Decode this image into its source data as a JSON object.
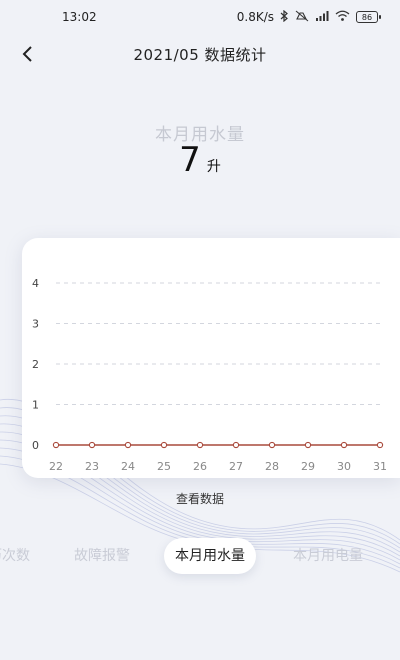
{
  "status_bar": {
    "time": "13:02",
    "network_speed": "0.8K/s",
    "icons": [
      "bluetooth-icon",
      "mute-icon",
      "signal-icon",
      "wifi-icon"
    ],
    "battery": "86"
  },
  "header": {
    "title": "2021/05 数据统计",
    "back_icon": "chevron-left-icon"
  },
  "summary": {
    "label": "本月用水量",
    "value": "7",
    "unit": "升"
  },
  "chart_data": {
    "type": "line",
    "x": [
      "22",
      "23",
      "24",
      "25",
      "26",
      "27",
      "28",
      "29",
      "30",
      "31"
    ],
    "values": [
      0,
      0,
      0,
      0,
      0,
      0,
      0,
      0,
      0,
      0
    ],
    "yticks": [
      "0",
      "1",
      "2",
      "3",
      "4"
    ],
    "ylim": [
      0,
      4
    ],
    "grid": true,
    "line_color": "#a94a3c",
    "title": "",
    "xlabel": "",
    "ylabel": ""
  },
  "view_data_label": "查看数据",
  "tabs": [
    {
      "label": "历次数",
      "active": false
    },
    {
      "label": "故障报警",
      "active": false
    },
    {
      "label": "本月用水量",
      "active": true
    },
    {
      "label": "本月用电量",
      "active": false
    }
  ]
}
